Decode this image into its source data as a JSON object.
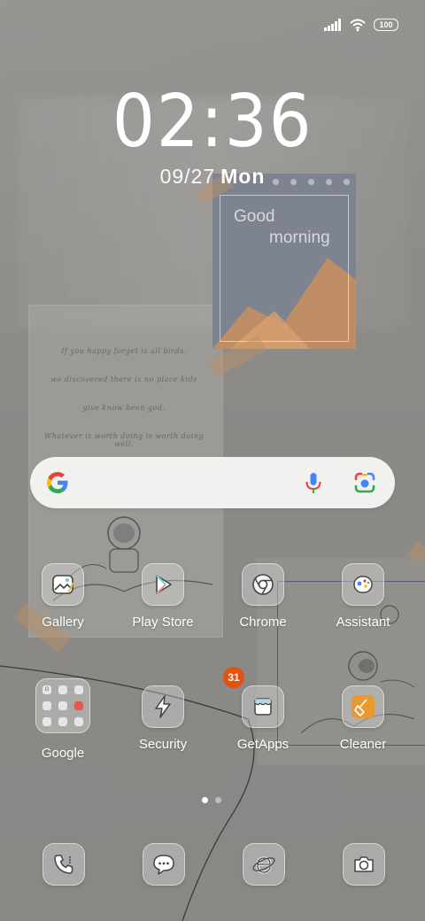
{
  "status_bar": {
    "battery": "100",
    "icons": [
      "signal-icon",
      "wifi-icon",
      "battery-icon"
    ]
  },
  "clock": {
    "time": "02:36",
    "date": "09/27",
    "day": "Mon"
  },
  "wallpaper": {
    "poster_line1": "Good",
    "poster_line2": "morning",
    "note_lines": [
      "If you happy forget is all birds.",
      "we discovered there is no place kids",
      "give know been god.",
      "Whatever is worth doing is worth doing well."
    ]
  },
  "search": {
    "icons": [
      "google-logo",
      "mic-icon",
      "lens-icon"
    ]
  },
  "apps_row1": [
    {
      "label": "Gallery",
      "icon": "gallery-icon"
    },
    {
      "label": "Play Store",
      "icon": "play-store-icon"
    },
    {
      "label": "Chrome",
      "icon": "chrome-icon"
    },
    {
      "label": "Assistant",
      "icon": "assistant-icon"
    }
  ],
  "apps_row2": [
    {
      "label": "Google",
      "icon": "google-folder-icon"
    },
    {
      "label": "Security",
      "icon": "security-icon"
    },
    {
      "label": "GetApps",
      "icon": "getapps-icon",
      "badge": "31"
    },
    {
      "label": "Cleaner",
      "icon": "cleaner-icon"
    }
  ],
  "page_indicator": {
    "count": 2,
    "active": 1
  },
  "dock": [
    "phone-icon",
    "messages-icon",
    "browser-icon",
    "camera-icon"
  ],
  "colors": {
    "badge": "#e8500f",
    "cleaner_accent": "#e99a2c",
    "search_bar": "#f1f1f0"
  }
}
